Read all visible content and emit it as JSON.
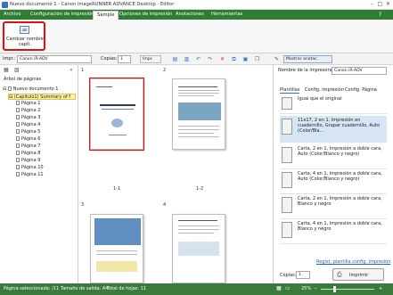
{
  "window": {
    "title": "Nuevo documento 1 - Canon imageRUNNER ADVANCE Desktop - Editor",
    "controls": [
      "–",
      "□",
      "✕"
    ]
  },
  "ribbon": {
    "tabs": [
      "Archivo",
      "Configuración de impresión",
      "Sample",
      "Opciones de impresión",
      "Anotaciones",
      "Herramientas"
    ],
    "active_tab": "Sample",
    "button_icon_text": "abl",
    "button_label": "Cambiar nombre capít."
  },
  "toolbar": {
    "printer_label": "Impr.:",
    "printer_value": "Canon iR-ADV",
    "copies_label": "Copias:",
    "copies_value": "1",
    "print_button": "Impr.",
    "show_annotations": "Mostrar anotac."
  },
  "left_panel": {
    "tree_title": "Árbol de páginas",
    "document": "Nuevo documento 1",
    "chapter": "(Capítulo1) Summary of f",
    "pages": [
      "Página 1",
      "Página 2",
      "Página 3",
      "Página 4",
      "Página 5",
      "Página 6",
      "Página 7",
      "Página 8",
      "Página 9",
      "Página 10",
      "Página 11"
    ]
  },
  "center": {
    "chapter_numbers": [
      "1",
      "2",
      "3",
      "4"
    ],
    "page_labels": [
      "1-1",
      "1-2"
    ]
  },
  "right_panel": {
    "printer_label": "Nombre de la impresora:",
    "printer_value": "Canon iR-ADV",
    "tabs": [
      "Plantillas",
      "Config. impresión",
      "Config. Página"
    ],
    "templates": [
      "Igual que el original",
      "11x17, 2 en 1, Impresión en cuadernillo, Grapar cuadernillo, Auto (Color/Bla...",
      "Carta, 2 en 1, Impresión a doble cara, Auto (Color/Blanco y negro)",
      "Carta, 4 en 1, Impresión a doble cara, Auto (Color/Blanco y negro)",
      "Carta, 2 en 1, Impresión a doble cara, Blanco y negro",
      "Carta, 4 en 1, Impresión a doble cara, Blanco y negro"
    ],
    "register_link": "Regist. plantilla config. impresión",
    "copies_label": "Copias:",
    "copies_value": "1",
    "print_button": "Imprimir"
  },
  "statusbar": {
    "selected_page": "Página seleccionada: /11",
    "output_size": "Tamaño de salida: A4",
    "total_sheets": "Total de hojas: 11",
    "zoom": "25%"
  }
}
